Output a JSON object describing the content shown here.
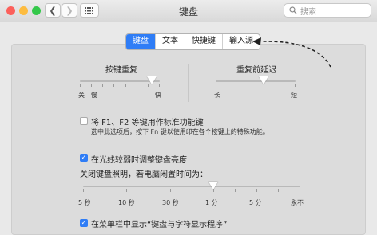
{
  "window": {
    "title": "键盘"
  },
  "search": {
    "placeholder": "搜索"
  },
  "tabs": [
    {
      "label": "键盘",
      "active": true
    },
    {
      "label": "文本",
      "active": false
    },
    {
      "label": "快捷键",
      "active": false
    },
    {
      "label": "输入源",
      "active": false
    }
  ],
  "key_repeat": {
    "label": "按键重复",
    "min_label": "关",
    "slow_label": "慢",
    "max_label": "快",
    "level": 0.9
  },
  "delay_until_repeat": {
    "label": "重复前延迟",
    "min_label": "长",
    "max_label": "短",
    "level": 0.6
  },
  "fn_keys": {
    "label": "将 F1、F2 等键用作标准功能键",
    "note": "选中此选项后，按下 Fn 键以使用印在各个按键上的特殊功能。",
    "checked": false
  },
  "auto_brightness": {
    "label": "在光线较弱时调整键盘亮度",
    "checked": true
  },
  "backlight_off": {
    "label": "关闭键盘照明，若电脑闲置时间为：",
    "ticks": [
      "5 秒",
      "10 秒",
      "30 秒",
      "1 分",
      "5 分",
      "永不"
    ],
    "value": "1 分"
  },
  "menu_bar": {
    "label": "在菜单栏中显示“键盘与字符显示程序”",
    "checked": true
  },
  "colors": {
    "accent": "#2f7df6",
    "close": "#fc605b",
    "minimize": "#fdbc40",
    "zoom": "#34c84a"
  },
  "icons": [
    "back-icon",
    "forward-icon",
    "grid-icon",
    "search-icon",
    "checkmark-icon",
    "annotation-arrow"
  ]
}
